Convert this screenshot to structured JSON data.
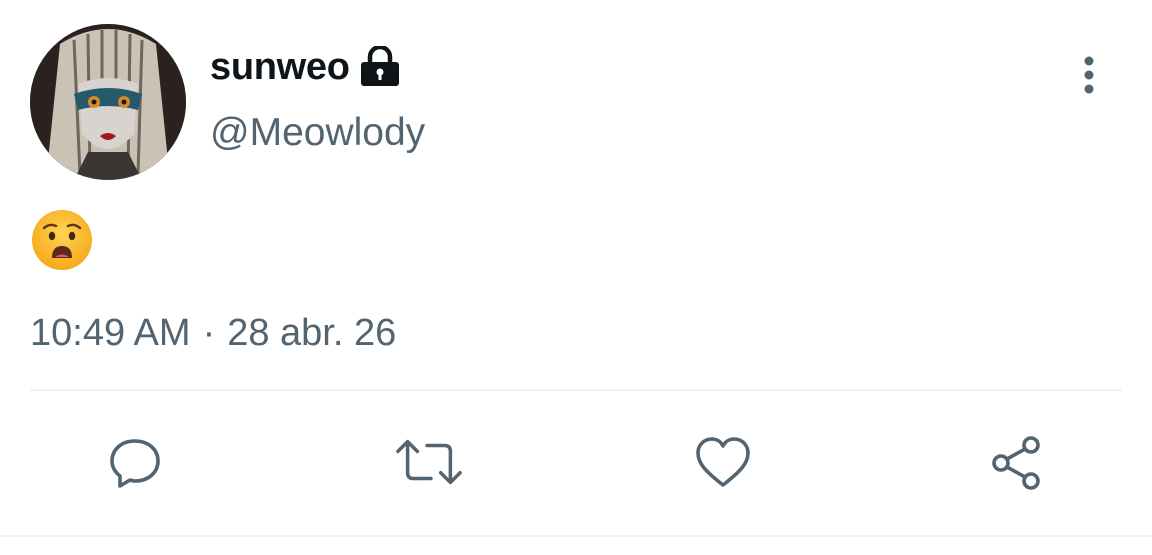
{
  "user": {
    "display_name": "sunweo",
    "handle": "@Meowlody",
    "protected_icon": "lock-icon",
    "avatar": "anime-style avatar"
  },
  "tweet": {
    "text": "😦",
    "time": "10:49 AM",
    "separator": "·",
    "date": "28 abr. 26"
  },
  "actions": [
    {
      "name": "reply",
      "icon": "reply-icon"
    },
    {
      "name": "retweet",
      "icon": "retweet-icon"
    },
    {
      "name": "like",
      "icon": "heart-icon"
    },
    {
      "name": "share",
      "icon": "share-icon"
    }
  ],
  "colors": {
    "text_primary": "#0f1419",
    "text_secondary": "#536471",
    "icon": "#536471",
    "divider": "#eff3f4"
  }
}
